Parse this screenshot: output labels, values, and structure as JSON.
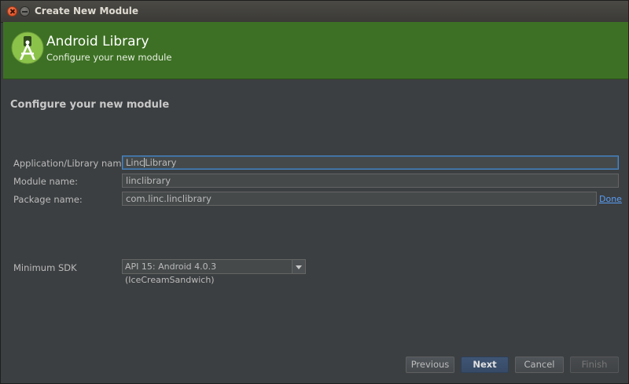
{
  "window": {
    "title": "Create New Module"
  },
  "header": {
    "title": "Android Library",
    "subtitle": "Configure your new module",
    "accent_color": "#3d7024"
  },
  "section": {
    "title": "Configure your new module"
  },
  "form": {
    "app_name": {
      "label": "Application/Library name:",
      "value_before_caret": "Linc",
      "value_after_caret": "Library"
    },
    "module_name": {
      "label": "Module name:",
      "value": "linclibrary"
    },
    "package_name": {
      "label": "Package name:",
      "value": "com.linc.linclibrary",
      "action": "Done"
    },
    "min_sdk": {
      "label": "Minimum SDK",
      "value": "API 15: Android 4.0.3 (IceCreamSandwich)"
    }
  },
  "buttons": {
    "previous": "Previous",
    "next": "Next",
    "cancel": "Cancel",
    "finish": "Finish"
  }
}
